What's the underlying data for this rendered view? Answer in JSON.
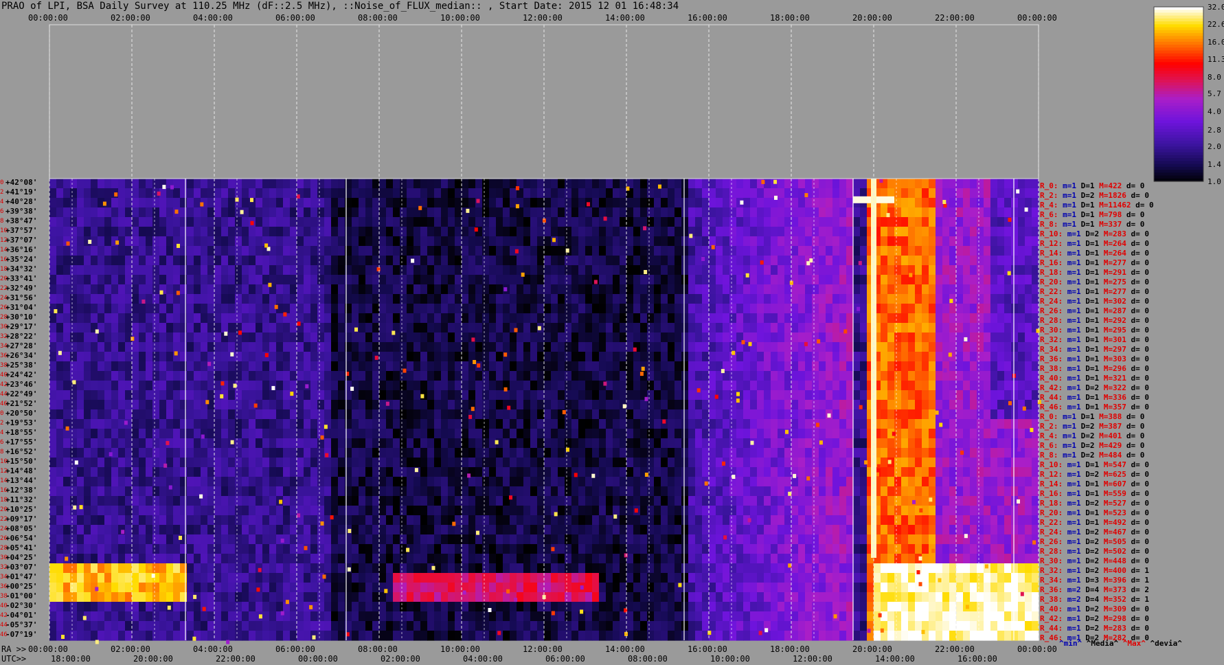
{
  "title": "PRAO of LPI, BSA Daily Survey at 110.25 MHz (dF::2.5 MHz), ::Noise_of_FLUX_median:: , Start Date: 2015 12 01 16:48:34",
  "chart_data": {
    "type": "heatmap",
    "title": "PRAO of LPI, BSA Daily Survey at 110.25 MHz (dF::2.5 MHz), ::Noise_of_FLUX_median:: , Start Date: 2015 12 01 16:48:34",
    "xlabel_ra": "RA >>",
    "xlabel_utc": "UTC>>",
    "top_ticks": [
      "00:00:00",
      "02:00:00",
      "04:00:00",
      "06:00:00",
      "08:00:00",
      "10:00:00",
      "12:00:00",
      "14:00:00",
      "16:00:00",
      "18:00:00",
      "20:00:00",
      "22:00:00",
      "00:00:00"
    ],
    "bottom_ra_ticks": [
      "00:00:00",
      "02:00:00",
      "04:00:00",
      "06:00:00",
      "08:00:00",
      "10:00:00",
      "12:00:00",
      "14:00:00",
      "16:00:00",
      "18:00:00",
      "20:00:00",
      "22:00:00",
      "00:00:00"
    ],
    "bottom_utc_ticks": [
      "18:00:00",
      "20:00:00",
      "22:00:00",
      "00:00:00",
      "02:00:00",
      "04:00:00",
      "06:00:00",
      "08:00:00",
      "10:00:00",
      "12:00:00",
      "14:00:00",
      "16:00:00"
    ],
    "declinations": [
      "+42°08'",
      "+41°19'",
      "+40°28'",
      "+39°38'",
      "+38°47'",
      "+37°57'",
      "+37°07'",
      "+36°16'",
      "+35°24'",
      "+34°32'",
      "+33°41'",
      "+32°49'",
      "+31°56'",
      "+31°04'",
      "+30°10'",
      "+29°17'",
      "+28°22'",
      "+27°28'",
      "+26°34'",
      "+25°38'",
      "+24°42'",
      "+23°46'",
      "+22°49'",
      "+21°52'",
      "+20°50'",
      "+19°53'",
      "+18°55'",
      "+17°55'",
      "+16°52'",
      "+15°50'",
      "+14°48'",
      "+13°44'",
      "+12°38'",
      "+11°32'",
      "+10°25'",
      "+09°17'",
      "+08°05'",
      "+06°54'",
      "+05°41'",
      "+04°25'",
      "+03°07'",
      "+01°47'",
      "+00°25'",
      "-01°00'",
      "-02°30'",
      "-04°01'",
      "-05°37'",
      "-07°19'"
    ],
    "row_indices": [
      "0",
      "2",
      "4",
      "6",
      "8",
      "10",
      "12",
      "14",
      "16",
      "18",
      "20",
      "22",
      "24",
      "26",
      "28",
      "30",
      "32",
      "34",
      "36",
      "38",
      "40",
      "42",
      "44",
      "46",
      "0",
      "2",
      "4",
      "6",
      "8",
      "10",
      "12",
      "14",
      "16",
      "18",
      "20",
      "22",
      "24",
      "26",
      "28",
      "30",
      "32",
      "34",
      "36",
      "38",
      "40",
      "42",
      "44",
      "46"
    ],
    "row_stats": [
      {
        "r": "R_0:",
        "m": "m=1",
        "d": "D=1",
        "M": "M=422",
        "dv": "d= 0"
      },
      {
        "r": "R_2:",
        "m": "m=1",
        "d": "D=2",
        "M": "M=1826",
        "dv": "d= 0"
      },
      {
        "r": "R_4:",
        "m": "m=1",
        "d": "D=1",
        "M": "M=11462",
        "dv": "d= 0"
      },
      {
        "r": "R_6:",
        "m": "m=1",
        "d": "D=1",
        "M": "M=798",
        "dv": "d= 0"
      },
      {
        "r": "R_8:",
        "m": "m=1",
        "d": "D=1",
        "M": "M=337",
        "dv": "d= 0"
      },
      {
        "r": "R_10:",
        "m": "m=1",
        "d": "D=2",
        "M": "M=283",
        "dv": "d= 0"
      },
      {
        "r": "R_12:",
        "m": "m=1",
        "d": "D=1",
        "M": "M=264",
        "dv": "d= 0"
      },
      {
        "r": "R_14:",
        "m": "m=1",
        "d": "D=1",
        "M": "M=264",
        "dv": "d= 0"
      },
      {
        "r": "R_16:",
        "m": "m=1",
        "d": "D=1",
        "M": "M=277",
        "dv": "d= 0"
      },
      {
        "r": "R_18:",
        "m": "m=1",
        "d": "D=1",
        "M": "M=291",
        "dv": "d= 0"
      },
      {
        "r": "R_20:",
        "m": "m=1",
        "d": "D=1",
        "M": "M=275",
        "dv": "d= 0"
      },
      {
        "r": "R_22:",
        "m": "m=1",
        "d": "D=1",
        "M": "M=277",
        "dv": "d= 0"
      },
      {
        "r": "R_24:",
        "m": "m=1",
        "d": "D=1",
        "M": "M=302",
        "dv": "d= 0"
      },
      {
        "r": "R_26:",
        "m": "m=1",
        "d": "D=1",
        "M": "M=287",
        "dv": "d= 0"
      },
      {
        "r": "R_28:",
        "m": "m=1",
        "d": "D=1",
        "M": "M=292",
        "dv": "d= 0"
      },
      {
        "r": "R_30:",
        "m": "m=1",
        "d": "D=1",
        "M": "M=295",
        "dv": "d= 0"
      },
      {
        "r": "R_32:",
        "m": "m=1",
        "d": "D=1",
        "M": "M=301",
        "dv": "d= 0"
      },
      {
        "r": "R_34:",
        "m": "m=1",
        "d": "D=1",
        "M": "M=297",
        "dv": "d= 0"
      },
      {
        "r": "R_36:",
        "m": "m=1",
        "d": "D=1",
        "M": "M=303",
        "dv": "d= 0"
      },
      {
        "r": "R_38:",
        "m": "m=1",
        "d": "D=1",
        "M": "M=296",
        "dv": "d= 0"
      },
      {
        "r": "R_40:",
        "m": "m=1",
        "d": "D=1",
        "M": "M=321",
        "dv": "d= 0"
      },
      {
        "r": "R_42:",
        "m": "m=1",
        "d": "D=2",
        "M": "M=322",
        "dv": "d= 0"
      },
      {
        "r": "R_44:",
        "m": "m=1",
        "d": "D=1",
        "M": "M=336",
        "dv": "d= 0"
      },
      {
        "r": "R_46:",
        "m": "m=1",
        "d": "D=1",
        "M": "M=357",
        "dv": "d= 0"
      },
      {
        "r": "R_0:",
        "m": "m=1",
        "d": "D=1",
        "M": "M=388",
        "dv": "d= 0"
      },
      {
        "r": "R_2:",
        "m": "m=1",
        "d": "D=2",
        "M": "M=387",
        "dv": "d= 0"
      },
      {
        "r": "R_4:",
        "m": "m=1",
        "d": "D=2",
        "M": "M=401",
        "dv": "d= 0"
      },
      {
        "r": "R_6:",
        "m": "m=1",
        "d": "D=2",
        "M": "M=429",
        "dv": "d= 0"
      },
      {
        "r": "R_8:",
        "m": "m=1",
        "d": "D=2",
        "M": "M=484",
        "dv": "d= 0"
      },
      {
        "r": "R_10:",
        "m": "m=1",
        "d": "D=1",
        "M": "M=547",
        "dv": "d= 0"
      },
      {
        "r": "R_12:",
        "m": "m=1",
        "d": "D=2",
        "M": "M=625",
        "dv": "d= 0"
      },
      {
        "r": "R_14:",
        "m": "m=1",
        "d": "D=1",
        "M": "M=607",
        "dv": "d= 0"
      },
      {
        "r": "R_16:",
        "m": "m=1",
        "d": "D=1",
        "M": "M=559",
        "dv": "d= 0"
      },
      {
        "r": "R_18:",
        "m": "m=1",
        "d": "D=2",
        "M": "M=527",
        "dv": "d= 0"
      },
      {
        "r": "R_20:",
        "m": "m=1",
        "d": "D=1",
        "M": "M=523",
        "dv": "d= 0"
      },
      {
        "r": "R_22:",
        "m": "m=1",
        "d": "D=1",
        "M": "M=492",
        "dv": "d= 0"
      },
      {
        "r": "R_24:",
        "m": "m=1",
        "d": "D=2",
        "M": "M=467",
        "dv": "d= 0"
      },
      {
        "r": "R_26:",
        "m": "m=1",
        "d": "D=2",
        "M": "M=505",
        "dv": "d= 0"
      },
      {
        "r": "R_28:",
        "m": "m=1",
        "d": "D=2",
        "M": "M=502",
        "dv": "d= 0"
      },
      {
        "r": "R_30:",
        "m": "m=1",
        "d": "D=2",
        "M": "M=448",
        "dv": "d= 0"
      },
      {
        "r": "R_32:",
        "m": "m=1",
        "d": "D=2",
        "M": "M=400",
        "dv": "d= 1"
      },
      {
        "r": "R_34:",
        "m": "m=1",
        "d": "D=3",
        "M": "M=396",
        "dv": "d= 1"
      },
      {
        "r": "R_36:",
        "m": "m=2",
        "d": "D=4",
        "M": "M=373",
        "dv": "d= 2"
      },
      {
        "r": "R_38:",
        "m": "m=2",
        "d": "D=4",
        "M": "M=352",
        "dv": "d= 1"
      },
      {
        "r": "R_40:",
        "m": "m=1",
        "d": "D=2",
        "M": "M=309",
        "dv": "d= 0"
      },
      {
        "r": "R_42:",
        "m": "m=1",
        "d": "D=2",
        "M": "M=298",
        "dv": "d= 0"
      },
      {
        "r": "R_44:",
        "m": "m=1",
        "d": "D=2",
        "M": "M=283",
        "dv": "d= 0"
      },
      {
        "r": "R_46:",
        "m": "m=1",
        "d": "D=2",
        "M": "M=282",
        "dv": "d= 0"
      }
    ],
    "stats_legend": {
      "min": "^min^",
      "media": "^Media^",
      "max": "^Max^",
      "devia": "^devia^"
    },
    "colorbar": {
      "ticks": [
        "32.0",
        "22.6",
        "16.0",
        "11.3",
        "8.0",
        "5.7",
        "4.0",
        "2.8",
        "2.0",
        "1.4",
        "1.0"
      ],
      "scale": "log",
      "range": [
        1.0,
        32.0
      ]
    },
    "features": [
      {
        "desc": "strong broadband band",
        "ra_start_h": 0.0,
        "ra_end_h": 3.4,
        "row_from": 40,
        "row_to": 43,
        "level": 22
      },
      {
        "desc": "broadband band",
        "ra_start_h": 8.4,
        "ra_end_h": 13.3,
        "row_from": 41,
        "row_to": 43,
        "level": 8
      },
      {
        "desc": "sun/interference column",
        "ra_start_h": 19.8,
        "ra_end_h": 21.5,
        "row_from": 0,
        "row_to": 47,
        "level": 16
      },
      {
        "desc": "strong region",
        "ra_start_h": 20.0,
        "ra_end_h": 24.0,
        "row_from": 40,
        "row_to": 47,
        "level": 32
      }
    ]
  }
}
